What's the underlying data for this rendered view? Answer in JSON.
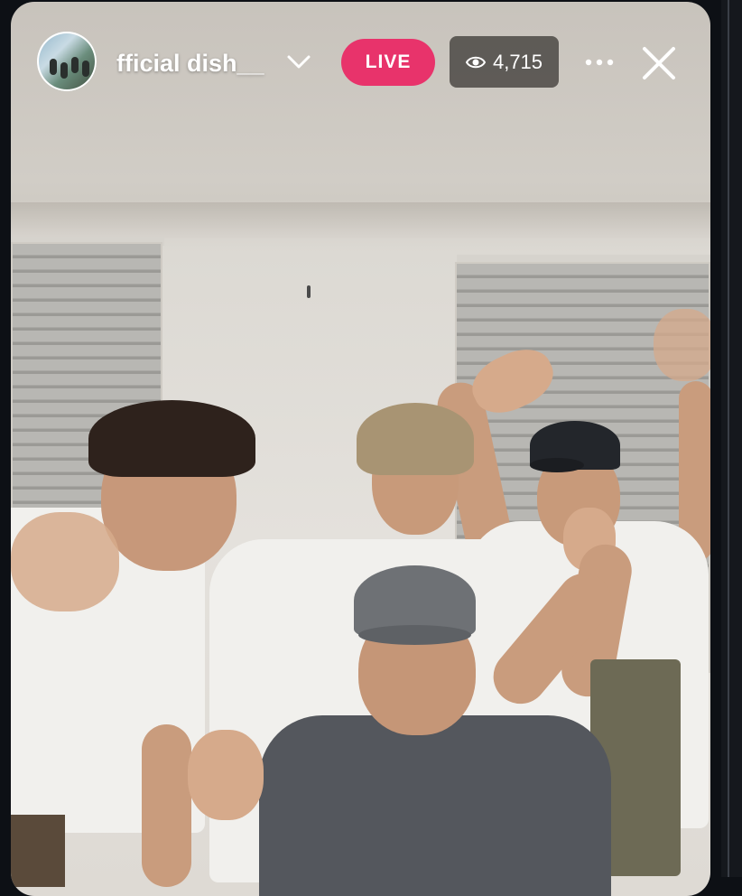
{
  "header": {
    "username": "fficial  dish__",
    "live_label": "LIVE",
    "viewer_count": "4,715"
  },
  "icons": {
    "avatar": "profile-avatar",
    "dropdown": "chevron-down-icon",
    "viewers": "eye-icon",
    "more": "more-horizontal-icon",
    "close": "close-icon"
  },
  "colors": {
    "live_badge": "#e8336b",
    "viewer_badge": "#4b4844",
    "text": "#ffffff"
  }
}
